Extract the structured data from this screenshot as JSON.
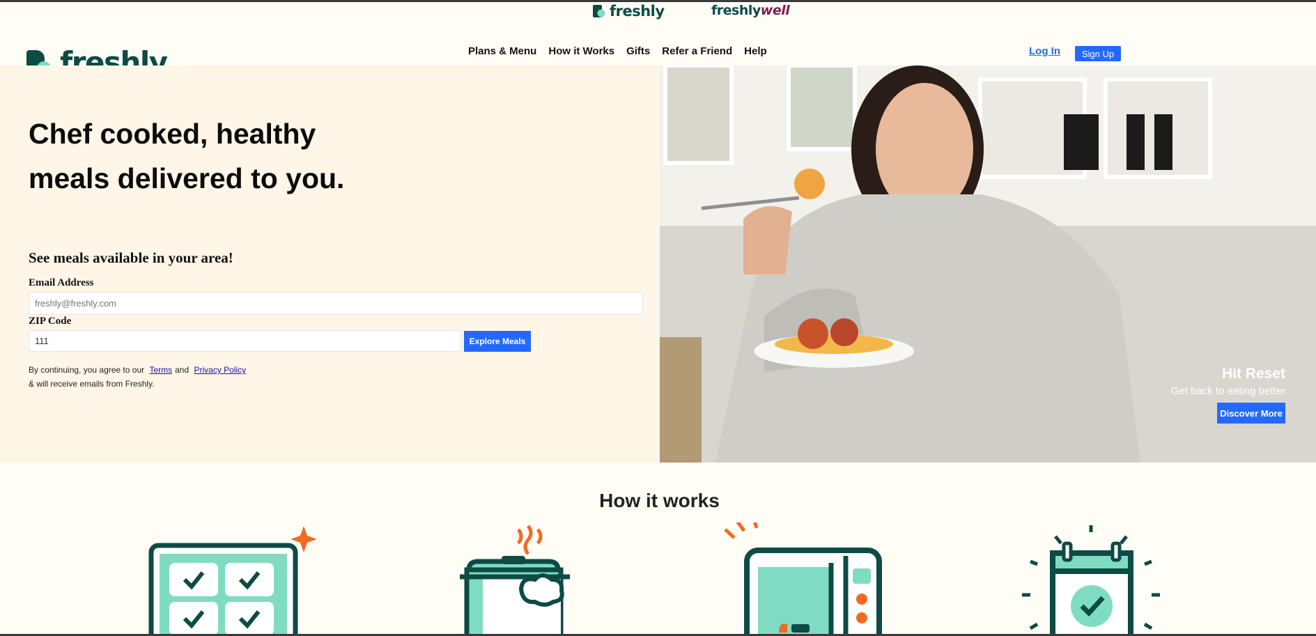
{
  "brand_switcher": {
    "freshly_label": "freshly",
    "freshlywell_prefix": "freshly",
    "freshlywell_suffix": "well"
  },
  "header": {
    "logo_text": "freshly",
    "nav": [
      {
        "label": "Plans & Menu"
      },
      {
        "label": "How it Works"
      },
      {
        "label": "Gifts"
      },
      {
        "label": "Refer a Friend"
      },
      {
        "label": "Help"
      }
    ],
    "login_label": "Log In",
    "signup_label": "Sign Up"
  },
  "hero": {
    "headline": "Chef cooked, healthy meals delivered to you.",
    "subhead": "See meals available in your area!",
    "email_label": "Email Address",
    "email_placeholder": "freshly@freshly.com",
    "zip_label": "ZIP Code",
    "zip_value": "111",
    "explore_label": "Explore Meals",
    "legal_prefix": "By continuing, you agree to our",
    "terms_label": "Terms",
    "and_label": "and",
    "privacy_label": "Privacy Policy",
    "legal_suffix": "& will receive emails from Freshly."
  },
  "promo": {
    "title": "Hit Reset",
    "subtitle": "Get back to eating better",
    "button_label": "Discover More"
  },
  "how_it_works": {
    "title": "How it works",
    "steps": [
      {
        "icon": "meal-grid-icon"
      },
      {
        "icon": "cooking-pot-icon"
      },
      {
        "icon": "microwave-icon"
      },
      {
        "icon": "calendar-check-icon"
      }
    ]
  },
  "colors": {
    "brand_teal": "#0d4b45",
    "brand_mint": "#7fdcc2",
    "accent_blue": "#2469ff",
    "accent_orange": "#f26a22",
    "hero_bg": "#fff6e8",
    "page_bg": "#fffdf6"
  }
}
